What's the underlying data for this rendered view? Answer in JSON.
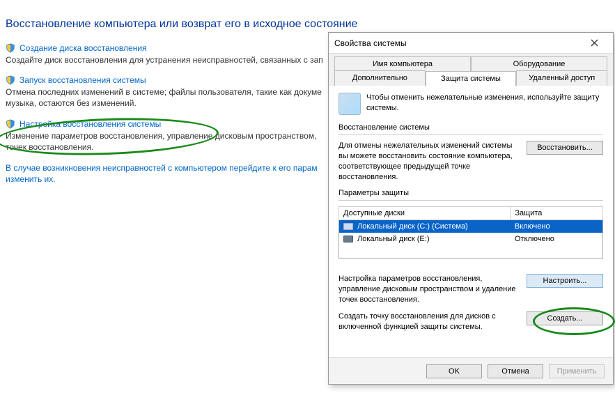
{
  "cp": {
    "title": "Восстановление компьютера или возврат его в исходное состояние",
    "links": [
      {
        "label": "Создание диска восстановления",
        "desc": "Создайте диск восстановления для устранения неисправностей, связанных с зап"
      },
      {
        "label": "Запуск восстановления системы",
        "desc": "Отмена последних изменений в системе; файлы пользователя, такие как докуме                              музыка, остаются без изменений."
      },
      {
        "label": "Настройка восстановления системы",
        "desc": "Изменение параметров восстановления, управление дисковым пространством,                                точек восстановления."
      }
    ],
    "footer": "В случае возникновения неисправностей с компьютером перейдите к его парам                                     изменить их."
  },
  "dialog": {
    "title": "Свойства системы",
    "tabs_row1": [
      "Имя компьютера",
      "Оборудование"
    ],
    "tabs_row2": [
      "Дополнительно",
      "Защита системы",
      "Удаленный доступ"
    ],
    "active_tab": "Защита системы",
    "banner": "Чтобы отменить нежелательные изменения, используйте защиту системы.",
    "section_restore": {
      "label": "Восстановление системы",
      "text": "Для отмены нежелательных изменений системы вы можете восстановить состояние компьютера, соответствующее предыдущей точке восстановления.",
      "button": "Восстановить..."
    },
    "section_params": {
      "label": "Параметры защиты",
      "col_disk": "Доступные диски",
      "col_prot": "Защита",
      "rows": [
        {
          "name": "Локальный диск (C:) (Система)",
          "prot": "Включено",
          "selected": true
        },
        {
          "name": "Локальный диск (E:)",
          "prot": "Отключено",
          "selected": false
        }
      ],
      "configure_text": "Настройка параметров восстановления, управление дисковым пространством и удаление точек восстановления.",
      "configure_btn": "Настроить...",
      "create_text": "Создать точку восстановления для дисков с включенной функцией защиты системы.",
      "create_btn": "Создать..."
    },
    "footer": {
      "ok": "OK",
      "cancel": "Отмена",
      "apply": "Применить"
    }
  }
}
